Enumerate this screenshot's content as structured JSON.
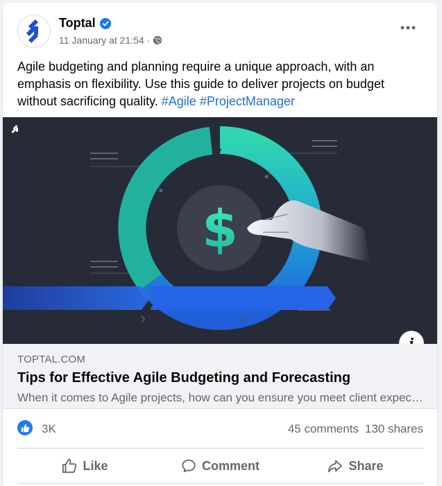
{
  "post": {
    "page_name": "Toptal",
    "timestamp": "11 January at 21:54",
    "separator": "·",
    "text": "Agile budgeting and planning require a unique approach, with an emphasis on flexibility. Use this guide to deliver projects on budget without sacrificing quality. ",
    "hashtags": [
      "#Agile",
      "#ProjectManager"
    ],
    "icons": {
      "verified": "verified-badge-icon",
      "audience": "globe-icon",
      "more": "more-options-icon",
      "info": "info-icon"
    }
  },
  "link_preview": {
    "domain": "TOPTAL.COM",
    "title": "Tips for Effective Agile Budgeting and Forecasting",
    "description": "When it comes to Agile projects, how can you ensure you meet client expectations without going over budget?"
  },
  "engagement": {
    "reaction_count": "3K",
    "comments": "45 comments",
    "shares": "130 shares"
  },
  "actions": {
    "like": "Like",
    "comment": "Comment",
    "share": "Share"
  },
  "colors": {
    "accent": "#216fdb",
    "like_blue": "#2078f4",
    "image_bg": "#262b37",
    "teal": "#2fd6b0",
    "blue": "#1f5ed8"
  }
}
